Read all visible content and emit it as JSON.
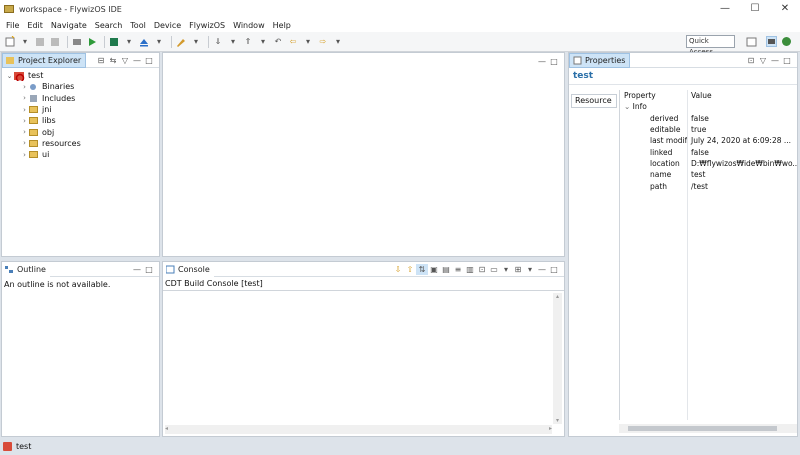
{
  "window": {
    "title": "workspace - FlywizOS IDE",
    "minimize": "—",
    "maximize": "☐",
    "close": "✕"
  },
  "menu": [
    "File",
    "Edit",
    "Navigate",
    "Search",
    "Tool",
    "Device",
    "FlywizOS",
    "Window",
    "Help"
  ],
  "toolbar": {
    "quick_access": "Quick Access"
  },
  "project_explorer": {
    "tab": "Project Explorer",
    "root": "test",
    "items": [
      "Binaries",
      "Includes",
      "jni",
      "libs",
      "obj",
      "resources",
      "ui"
    ]
  },
  "outline": {
    "tab": "Outline",
    "message": "An outline is not available."
  },
  "console": {
    "tab": "Console",
    "title": "CDT Build Console [test]"
  },
  "properties": {
    "tab": "Properties",
    "heading": "test",
    "resource_tab": "Resource",
    "col_property": "Property",
    "col_value": "Value",
    "group": "Info",
    "rows": [
      {
        "k": "derived",
        "v": "false"
      },
      {
        "k": "editable",
        "v": "true"
      },
      {
        "k": "last modifie",
        "v": "July 24, 2020 at 6:09:28 ..."
      },
      {
        "k": "linked",
        "v": "false"
      },
      {
        "k": "location",
        "v": "D:₩flywizos₩ide₩bin₩wo..."
      },
      {
        "k": "name",
        "v": "test"
      },
      {
        "k": "path",
        "v": "/test"
      }
    ]
  },
  "statusbar": {
    "text": "test"
  },
  "colors": {
    "accent": "#2a6fa8",
    "tab_active": "#cde3f6",
    "folder": "#e8c25b"
  }
}
